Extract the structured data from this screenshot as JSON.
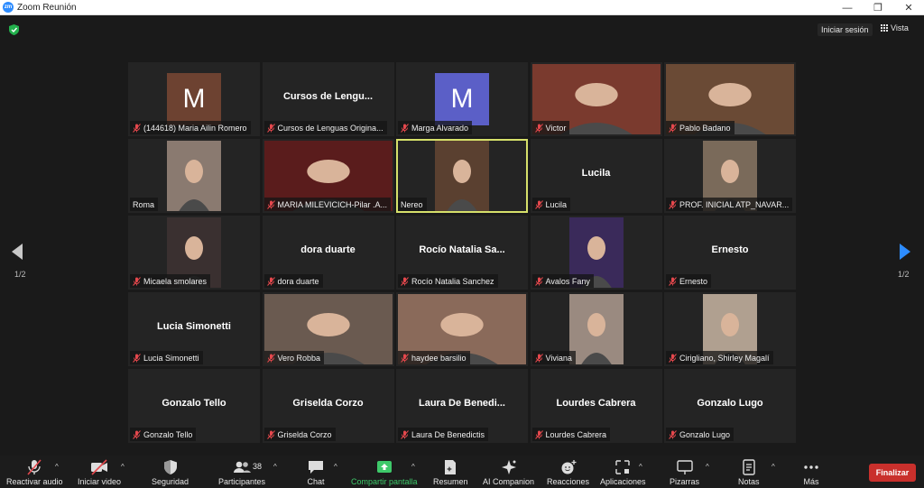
{
  "window": {
    "title": "Zoom Reunión",
    "logo_text": "zm"
  },
  "topbar": {
    "signin_label": "Iniciar sesión",
    "view_label": "Vista"
  },
  "pagination": {
    "left": "1/2",
    "right": "1/2"
  },
  "participants": [
    {
      "label": "(144618) Maria Ailin Romero",
      "initial": "M",
      "avatar_color": "#6d4231",
      "kind": "avatar"
    },
    {
      "label": "Cursos de Lenguas Origina...",
      "bigname": "Cursos de Lengu...",
      "kind": "name"
    },
    {
      "label": "Marga Alvarado",
      "initial": "M",
      "avatar_color": "#5b5fc7",
      "kind": "avatar"
    },
    {
      "label": "Victor",
      "kind": "video",
      "bg": "#7a3a2e",
      "wide": true
    },
    {
      "label": "Pablo Badano",
      "kind": "video",
      "bg": "#6a4a35",
      "wide": true
    },
    {
      "label": "Roma",
      "kind": "video",
      "bg": "#8a7a70",
      "nomic": true
    },
    {
      "label": "MARIA MILEVICICH-Pilar .A...",
      "kind": "video",
      "bg": "#5a1c1c",
      "wide": true
    },
    {
      "label": "Nereo",
      "kind": "video",
      "bg": "#5a4030",
      "nomic": true,
      "active": true
    },
    {
      "label": "Lucila",
      "bigname": "Lucila",
      "kind": "name"
    },
    {
      "label": "PROF. INICIAL ATP_NAVAR...",
      "kind": "video",
      "bg": "#7a6a5a"
    },
    {
      "label": "Micaela smolares",
      "kind": "video",
      "bg": "#3a3030"
    },
    {
      "label": "dora duarte",
      "bigname": "dora duarte",
      "kind": "name"
    },
    {
      "label": "Rocío Natalia Sanchez",
      "bigname": "Rocío Natalia Sa...",
      "kind": "name"
    },
    {
      "label": "Avalos Fany",
      "kind": "video",
      "bg": "#3a2a5a"
    },
    {
      "label": "Ernesto",
      "bigname": "Ernesto",
      "kind": "name"
    },
    {
      "label": "Lucia Simonetti",
      "bigname": "Lucia Simonetti",
      "kind": "name"
    },
    {
      "label": "Vero Robba",
      "kind": "video",
      "bg": "#6a5a50",
      "wide": true
    },
    {
      "label": "haydee barsilio",
      "kind": "video",
      "bg": "#8a6a5a",
      "wide": true
    },
    {
      "label": "Viviana",
      "kind": "video",
      "bg": "#9a8a80"
    },
    {
      "label": "Cirigliano, Shirley Magalí",
      "kind": "video",
      "bg": "#b0a090"
    },
    {
      "label": "Gonzalo Tello",
      "bigname": "Gonzalo Tello",
      "kind": "name"
    },
    {
      "label": "Griselda Corzo",
      "bigname": "Griselda Corzo",
      "kind": "name"
    },
    {
      "label": "Laura De Benedictis",
      "bigname": "Laura De Benedi...",
      "kind": "name"
    },
    {
      "label": "Lourdes Cabrera",
      "bigname": "Lourdes Cabrera",
      "kind": "name"
    },
    {
      "label": "Gonzalo Lugo",
      "bigname": "Gonzalo Lugo",
      "kind": "name"
    }
  ],
  "toolbar": {
    "mute": "Reactivar audio",
    "video": "Iniciar video",
    "security": "Seguridad",
    "participants": "Participantes",
    "participants_count": "38",
    "chat": "Chat",
    "share": "Compartir pantalla",
    "summary": "Resumen",
    "companion": "AI Companion",
    "reactions": "Reacciones",
    "apps": "Aplicaciones",
    "whiteboards": "Pizarras",
    "notes": "Notas",
    "more": "Más",
    "end": "Finalizar"
  },
  "colors": {
    "accent": "#2d8cff",
    "share_green": "#3ec96a",
    "end_red": "#c9302c",
    "mic_off_red": "#e5484d",
    "active_border": "#d6e06a"
  }
}
